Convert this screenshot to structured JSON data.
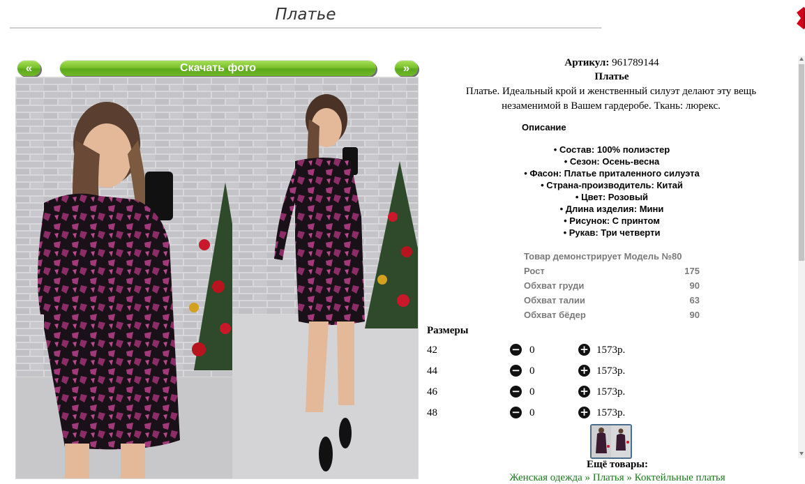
{
  "page": {
    "title": "Платье"
  },
  "gallery": {
    "prev_label": "«",
    "download_label": "Скачать фото",
    "next_label": "»"
  },
  "product": {
    "sku_label": "Артикул:",
    "sku_value": "961789144",
    "name": "Платье",
    "description": "Платье. Идеальный крой и женственный силуэт делают эту вещь незаменимой в Вашем гардеробе. Ткань: люрекс.",
    "description_heading": "Описание",
    "attributes": [
      "• Состав: 100% полиэстер",
      "• Сезон: Осень-весна",
      "• Фасон: Платье приталенного силуэта",
      "• Страна-производитель: Китай",
      "• Цвет: Розовый",
      "• Длина изделия: Мини",
      "• Рисунок: С принтом",
      "• Рукав: Три четверти"
    ]
  },
  "model": {
    "heading": "Товар демонстрирует Модель №80",
    "rows": [
      {
        "label": "Рост",
        "value": "175"
      },
      {
        "label": "Обхват груди",
        "value": "90"
      },
      {
        "label": "Обхват талии",
        "value": "63"
      },
      {
        "label": "Обхват бёдер",
        "value": "90"
      }
    ]
  },
  "sizes": {
    "heading": "Размеры",
    "minus_icon": "minus-circle-icon",
    "plus_icon": "plus-circle-icon",
    "rows": [
      {
        "size": "42",
        "qty": "0",
        "price": "1573р."
      },
      {
        "size": "44",
        "qty": "0",
        "price": "1573р."
      },
      {
        "size": "46",
        "qty": "0",
        "price": "1573р."
      },
      {
        "size": "48",
        "qty": "0",
        "price": "1573р."
      }
    ]
  },
  "more": {
    "heading": "Ещё товары:",
    "links_text": "Женская одежда » Платья » Коктейльные платья"
  },
  "colors": {
    "button_green": "#79c12b",
    "link_green": "#1a7a1a",
    "model_gray": "#7a7a7a",
    "close_red": "#d0021b"
  }
}
